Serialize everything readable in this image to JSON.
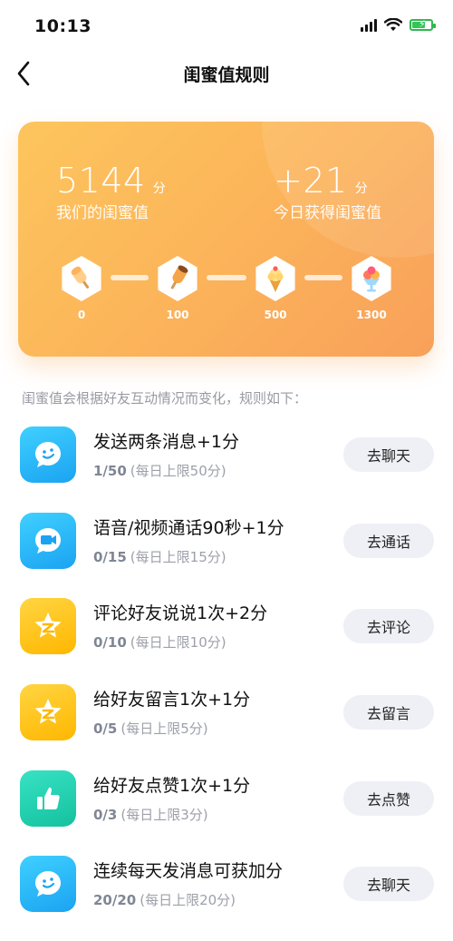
{
  "status": {
    "time": "10:13",
    "battery_level": 0.8
  },
  "nav": {
    "title": "闺蜜值规则"
  },
  "summary": {
    "total_value": "5144",
    "total_unit": "分",
    "total_label": "我们的闺蜜值",
    "today_value": "+21",
    "today_unit": "分",
    "today_label": "今日获得闺蜜值"
  },
  "levels": [
    {
      "threshold": "0",
      "icon": "popsicle-icon"
    },
    {
      "threshold": "100",
      "icon": "ice-lolly-icon"
    },
    {
      "threshold": "500",
      "icon": "ice-cream-cone-icon"
    },
    {
      "threshold": "1300",
      "icon": "sundae-icon"
    }
  ],
  "intro": "闺蜜值会根据好友互动情况而变化，规则如下：",
  "rules": [
    {
      "title": "发送两条消息+1分",
      "progress": "1/50",
      "limit": "(每日上限50分)",
      "action": "去聊天",
      "icon": "chat-smile-icon",
      "color": "#1fb0f5"
    },
    {
      "title": "语音/视频通话90秒+1分",
      "progress": "0/15",
      "limit": "(每日上限15分)",
      "action": "去通话",
      "icon": "video-call-icon",
      "color": "#1fb0f5"
    },
    {
      "title": "评论好友说说1次+2分",
      "progress": "0/10",
      "limit": "(每日上限10分)",
      "action": "去评论",
      "icon": "qzone-star-icon",
      "color": "#ffc21a"
    },
    {
      "title": "给好友留言1次+1分",
      "progress": "0/5",
      "limit": "(每日上限5分)",
      "action": "去留言",
      "icon": "qzone-star-icon",
      "color": "#ffc21a"
    },
    {
      "title": "给好友点赞1次+1分",
      "progress": "0/3",
      "limit": "(每日上限3分)",
      "action": "去点赞",
      "icon": "thumbs-up-icon",
      "color": "#1ec9a7"
    },
    {
      "title": "连续每天发消息可获加分",
      "progress": "20/20",
      "limit": "(每日上限20分)",
      "action": "去聊天",
      "icon": "chat-smile-icon",
      "color": "#1fb0f5"
    }
  ]
}
